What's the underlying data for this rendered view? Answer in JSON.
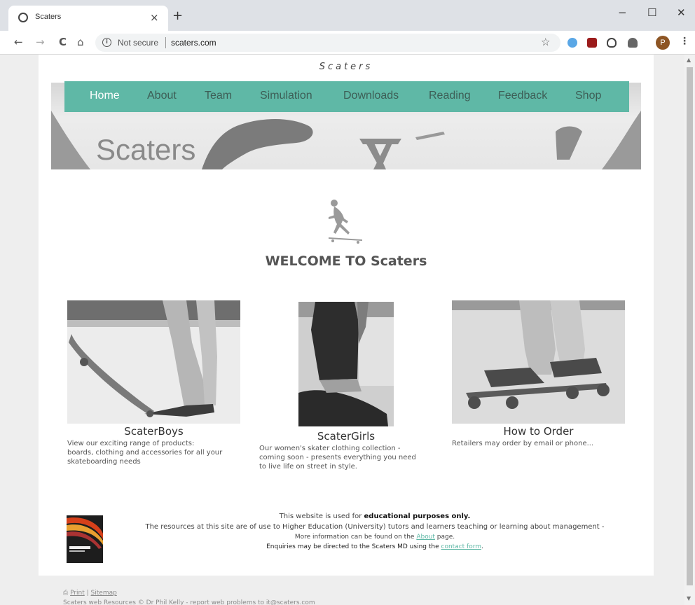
{
  "browser": {
    "tab_title": "Scaters",
    "tab_close": "×",
    "new_tab": "+",
    "minimize": "−",
    "maximize": "☐",
    "close": "✕",
    "back": "←",
    "forward": "→",
    "reload": "C",
    "home": "⌂",
    "security_label": "Not secure",
    "url": "scaters.com",
    "bookmark": "☆",
    "profile_initial": "P",
    "menu": "⋮"
  },
  "site": {
    "header_name": "Scaters",
    "banner_title": "Scaters",
    "nav": [
      {
        "label": "Home",
        "active": true
      },
      {
        "label": "About"
      },
      {
        "label": "Team"
      },
      {
        "label": "Simulation"
      },
      {
        "label": "Downloads"
      },
      {
        "label": "Reading"
      },
      {
        "label": "Feedback"
      },
      {
        "label": "Shop"
      }
    ],
    "welcome": "WELCOME TO Scaters",
    "cards": [
      {
        "title": "ScaterBoys",
        "desc_lines": [
          "View our exciting  range of products:",
          "boards, clothing and accessories for all your",
          "skateboarding needs"
        ]
      },
      {
        "title": "ScaterGirls",
        "desc_lines": [
          "Our women's skater clothing collection -",
          "coming soon - presents everything you need",
          "to live life on street in style."
        ]
      },
      {
        "title": "How to Order",
        "desc_lines": [
          "Retailers may order by email or phone..."
        ]
      }
    ],
    "footer": {
      "line1_prefix": "This website is used for ",
      "line1_bold": "educational purposes only",
      "line1_suffix": ".",
      "line2": "The resources at this site are of use to Higher Education (University) tutors and learners teaching or learning about management -",
      "line3_prefix": "More information can be found on the ",
      "line3_link": "About",
      "line3_suffix": " page.",
      "line4_prefix": "Enquiries may be directed to the Scaters MD using the ",
      "line4_link": "contact form",
      "line4_suffix": "."
    },
    "below_links": {
      "print": "Print",
      "sep": " | ",
      "sitemap": "Sitemap",
      "credit": "Scaters web Resources © Dr Phil Kelly - report web problems to it@scaters.com"
    }
  },
  "colors": {
    "nav_bg": "#5fb8a6",
    "nav_text": "#3d5e56",
    "nav_active": "#ffffff",
    "link": "#5fb8a6"
  }
}
